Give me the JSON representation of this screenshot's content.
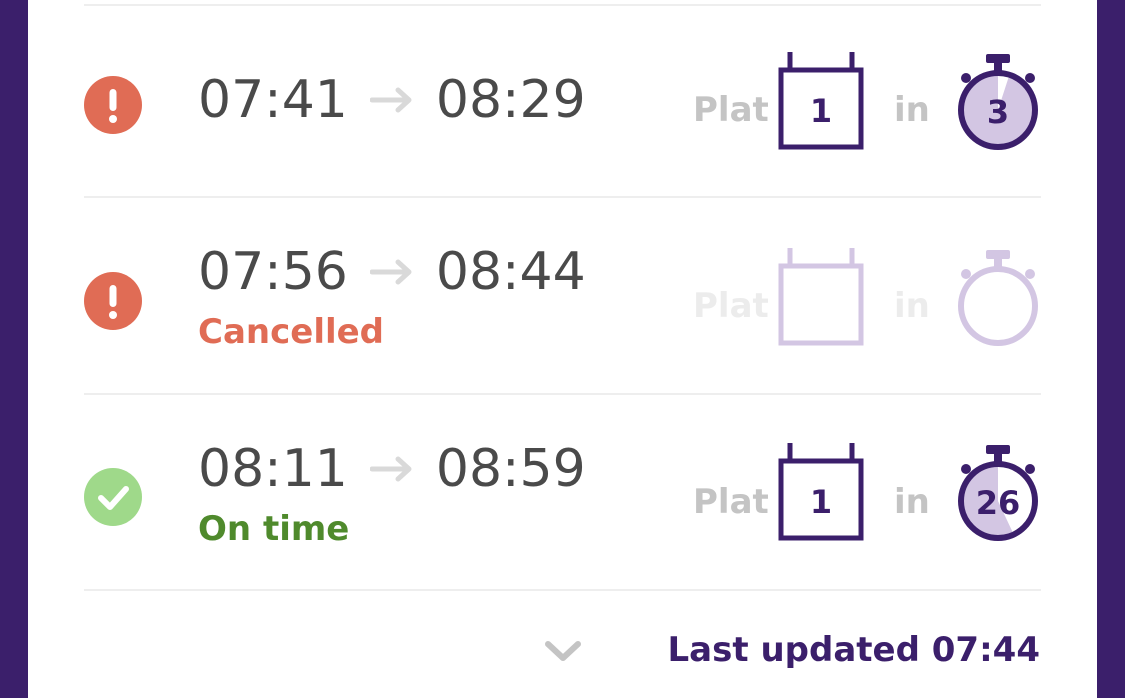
{
  "trains": [
    {
      "depart": "07:41",
      "arrive": "08:29",
      "status": "alert",
      "status_text": "",
      "plat_label": "Plat",
      "platform": "1",
      "in_label": "in",
      "minutes": "3",
      "countdown_fraction": 0.05
    },
    {
      "depart": "07:56",
      "arrive": "08:44",
      "status": "alert",
      "status_text": "Cancelled",
      "plat_label": "Plat",
      "platform": "",
      "in_label": "in",
      "minutes": ""
    },
    {
      "depart": "08:11",
      "arrive": "08:59",
      "status": "ok",
      "status_text": "On time",
      "plat_label": "Plat",
      "platform": "1",
      "in_label": "in",
      "minutes": "26",
      "countdown_fraction": 0.43
    }
  ],
  "footer": {
    "last_updated": "Last updated 07:44"
  },
  "icons": {
    "alert": "exclamation-circle-icon",
    "ok": "check-circle-icon",
    "arrow": "arrow-right-icon",
    "platform": "platform-board-icon",
    "timer": "stopwatch-icon",
    "expand": "chevron-down-icon"
  },
  "colors": {
    "brand": "#3b1f6b",
    "alert": "#e06c55",
    "ok": "#9fd98a",
    "ok_text": "#4f8a2c",
    "cancelled_text": "#e06c55",
    "muted": "#c4c4c4",
    "faded_brand": "#d3c6e3"
  }
}
